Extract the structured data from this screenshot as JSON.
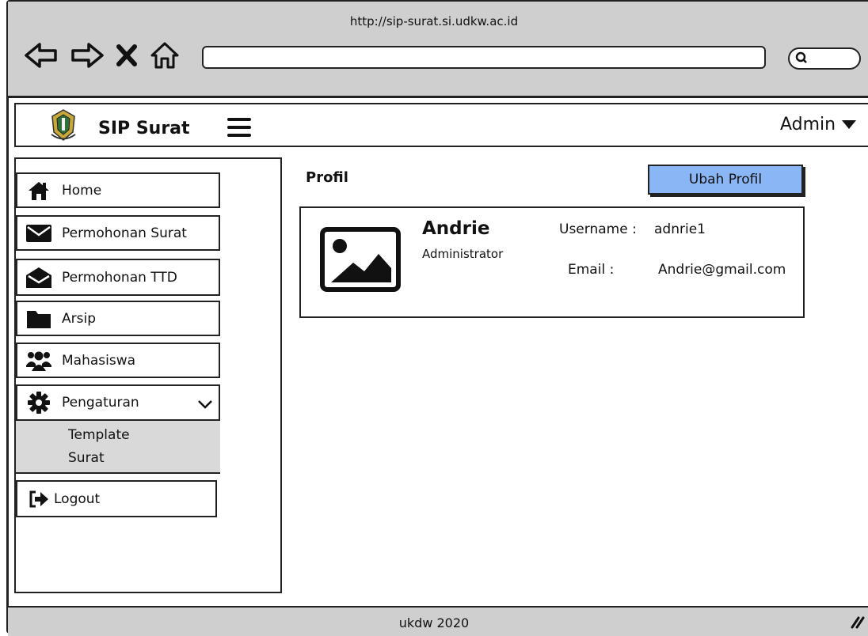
{
  "browser": {
    "url": "http://sip-surat.si.udkw.ac.id"
  },
  "header": {
    "brand": "SIP Surat",
    "user": "Admin"
  },
  "sidebar": {
    "items": [
      {
        "label": "Home",
        "icon": "home-icon"
      },
      {
        "label": "Permohonan Surat",
        "icon": "envelope-icon"
      },
      {
        "label": "Permohonan TTD",
        "icon": "envelope-open-icon"
      },
      {
        "label": "Arsip",
        "icon": "folder-icon"
      },
      {
        "label": "Mahasiswa",
        "icon": "users-icon"
      },
      {
        "label": "Pengaturan",
        "icon": "gear-icon"
      }
    ],
    "submenu": [
      "Template",
      "Surat"
    ],
    "logout": {
      "label": "Logout",
      "icon": "logout-icon"
    }
  },
  "main": {
    "title": "Profil",
    "edit_button": "Ubah Profil",
    "profile": {
      "name": "Andrie",
      "role": "Administrator",
      "username_label": "Username :",
      "username_value": "adnrie1",
      "email_label": "Email :",
      "email_value": "Andrie@gmail.com"
    }
  },
  "footer": {
    "text": "ukdw 2020"
  },
  "colors": {
    "accent": "#8bb6f5",
    "chrome": "#cfcfcf",
    "submenu": "#d9d9d9"
  }
}
